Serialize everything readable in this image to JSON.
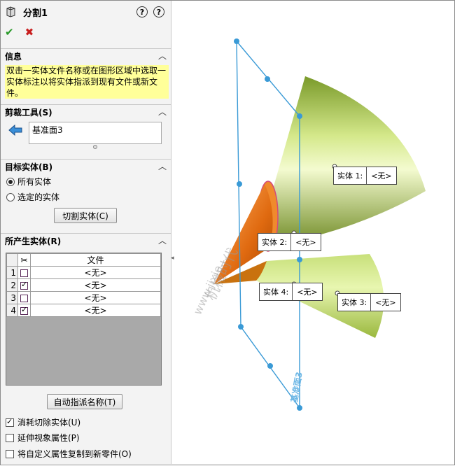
{
  "title": "分割1",
  "help": {
    "q1": "?",
    "q2": "?"
  },
  "actions": {
    "ok": "✔",
    "cancel": "✖"
  },
  "info": {
    "header": "信息",
    "text": "双击一实体文件名称或在图形区域中选取一实体标注以将实体指派到现有文件或新文件。"
  },
  "trim": {
    "header": "剪裁工具(S)",
    "value": "基准面3"
  },
  "target": {
    "header": "目标实体(B)",
    "all": "所有实体",
    "selected": "选定的实体",
    "cut_button": "切割实体(C)"
  },
  "result": {
    "header": "所产生实体(R)",
    "col_file": "文件",
    "rows": [
      {
        "num": "1",
        "checked": false,
        "file": "<无>"
      },
      {
        "num": "2",
        "checked": true,
        "file": "<无>"
      },
      {
        "num": "3",
        "checked": false,
        "file": "<无>"
      },
      {
        "num": "4",
        "checked": true,
        "file": "<无>"
      }
    ],
    "auto_button": "自动指派名称(T)"
  },
  "options": {
    "consume": "消耗切除实体(U)",
    "extend": "延伸视象属性(P)",
    "copy": "将自定义属性复制到新零件(O)"
  },
  "labels": [
    {
      "k": "实体 1:",
      "v": "<无>"
    },
    {
      "k": "实体 2:",
      "v": "<无>"
    },
    {
      "k": "实体 3:",
      "v": "<无>"
    },
    {
      "k": "实体 4:",
      "v": "<无>"
    }
  ],
  "plane_label": "基准面3",
  "watermark": {
    "cn": "机械时代",
    "url": "www.jixie..."
  }
}
